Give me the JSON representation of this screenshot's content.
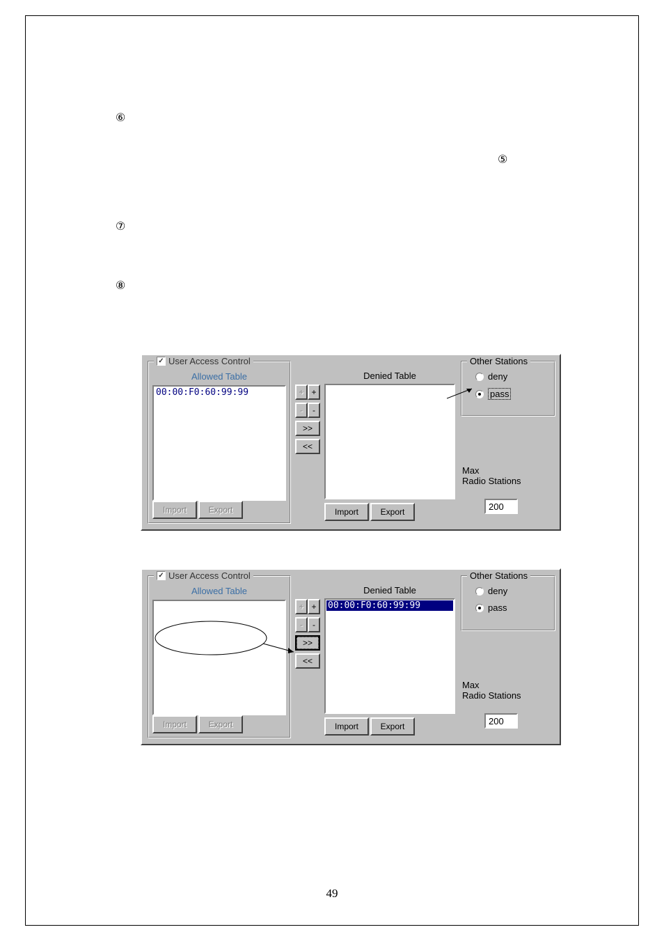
{
  "markers": {
    "n5": "⑤",
    "n6": "⑥",
    "n7": "⑦",
    "n8": "⑧"
  },
  "panel": {
    "checkbox_check": "✓",
    "title": "User Access Control",
    "allowed_label": "Allowed Table",
    "denied_label": "Denied Table",
    "mac1": "00:00:F0:60:99:99",
    "import": "Import",
    "export": "Export",
    "plus_disabled": "+",
    "plus": "+",
    "minus_disabled": "-",
    "minus": "-",
    "move_right": ">>",
    "move_left": "<<",
    "other_stations_title": "Other Stations",
    "deny": "deny",
    "pass": "pass",
    "max_label": "Max\nRadio Stations",
    "max_value": "200"
  },
  "page_number": "49"
}
